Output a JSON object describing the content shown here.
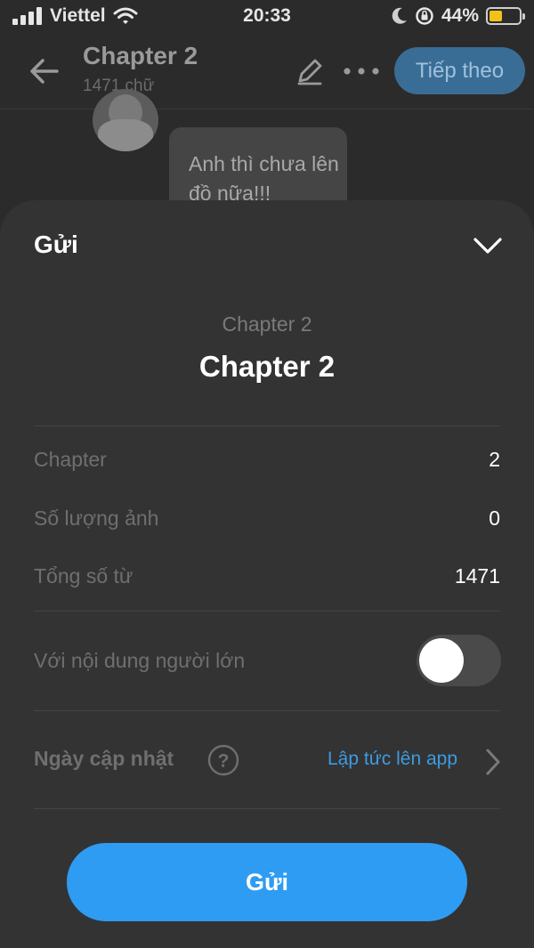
{
  "status_bar": {
    "carrier": "Viettel",
    "time": "20:33",
    "battery_percent": "44%",
    "battery_level": 0.44
  },
  "nav": {
    "title": "Chapter 2",
    "word_count": "1471 chữ",
    "next_label": "Tiếp theo"
  },
  "chat": {
    "message": "Anh thì chưa lên đồ nữa!!!"
  },
  "sheet": {
    "title": "Gửi",
    "story_label": "Chapter 2",
    "chapter_title": "Chapter 2",
    "rows": [
      {
        "label": "Chapter",
        "value": "2"
      },
      {
        "label": "Số lượng ảnh",
        "value": "0"
      },
      {
        "label": "Tổng số từ",
        "value": "1471"
      }
    ],
    "adult_content": {
      "label": "Với nội dung người lớn",
      "enabled": false
    },
    "update_date": {
      "label": "Ngày cập nhật",
      "value": "Lập tức lên app"
    },
    "submit_label": "Gửi"
  },
  "colors": {
    "accent": "#2e9cf3",
    "link": "#3d9be0",
    "sheet_bg": "#333333",
    "battery": "#f1c21b"
  },
  "icons": [
    "signal-icon",
    "wifi-icon",
    "moon-icon",
    "rotation-lock-icon",
    "battery-icon",
    "back-arrow-icon",
    "pencil-icon",
    "more-icon",
    "chevron-down-icon",
    "help-icon",
    "chevron-right-icon"
  ]
}
